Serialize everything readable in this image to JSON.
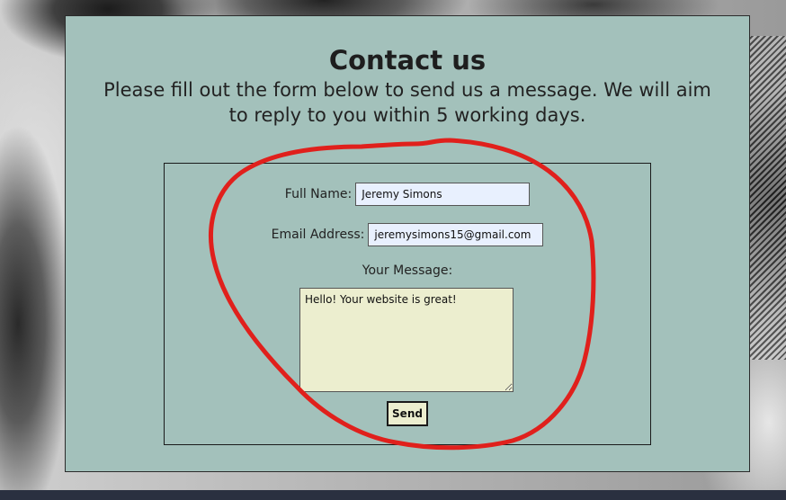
{
  "page": {
    "title": "Contact us",
    "subtitle": "Please fill out the form below to send us a message. We will aim to reply to you within 5 working days."
  },
  "form": {
    "full_name_label": "Full Name:",
    "full_name_value": "Jeremy Simons",
    "email_label": "Email Address:",
    "email_value": "jeremysimons15@gmail.com",
    "message_label": "Your Message:",
    "message_value": "Hello! Your website is great!",
    "send_label": "Send"
  },
  "colors": {
    "card_background": "#a3c1bb",
    "input_autofill": "#e8f0fe",
    "textarea_background": "#eceecf",
    "annotation_stroke": "#e0201c",
    "bottom_bar": "#2a3040"
  }
}
